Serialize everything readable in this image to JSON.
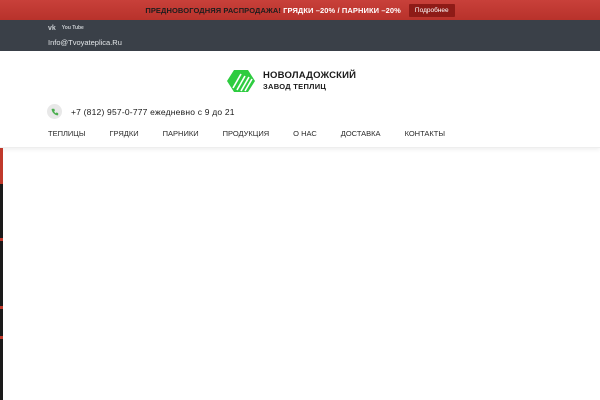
{
  "promo": {
    "text_prefix": "ПРЕДНОВОГОДНЯЯ РАСПРОДАЖА!",
    "text_highlight": "ГРЯДКИ –20% / ПАРНИКИ –20%",
    "button_label": "Подробнее"
  },
  "topbar": {
    "vk_label": "vk",
    "youtube_label": "You Tube",
    "email": "Info@Tvoyateplica.Ru"
  },
  "logo": {
    "name": "НОВОЛАДОЖСКИЙ",
    "subtitle": "ЗАВОД ТЕПЛИЦ"
  },
  "contact": {
    "phone_text": "+7 (812) 957-0-777 ежедневно с 9 до 21"
  },
  "nav": {
    "items": [
      "ТЕПЛИЦЫ",
      "ГРЯДКИ",
      "ПАРНИКИ",
      "ПРОДУКЦИЯ",
      "О НАС",
      "ДОСТАВКА",
      "КОНТАКТЫ"
    ]
  },
  "colors": {
    "promo_bg": "#c0392b",
    "topbar_bg": "#3a4048",
    "logo_green": "#2ecc40",
    "accent_dark_red": "#8e1b17"
  }
}
